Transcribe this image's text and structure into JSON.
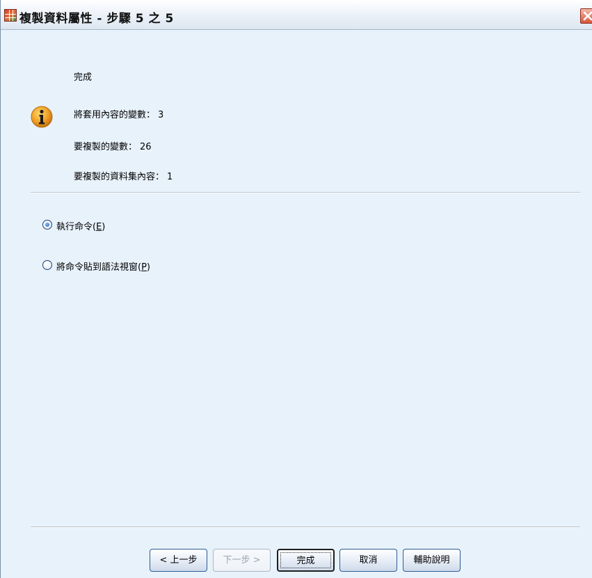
{
  "window": {
    "title": "複製資料屬性 - 步驟 5 之 5"
  },
  "content": {
    "heading": "完成",
    "stats": [
      {
        "label": "將套用內容的變數：",
        "value": "3"
      },
      {
        "label": "要複製的變數：",
        "value": "26"
      },
      {
        "label": "要複製的資料集內容：",
        "value": "1"
      }
    ]
  },
  "options": {
    "run_prefix": "執行命令(",
    "run_accel": "E",
    "run_suffix": ")",
    "paste_prefix": "將命令貼到語法視窗(",
    "paste_accel": "P",
    "paste_suffix": ")",
    "selected": "run"
  },
  "buttons": {
    "back": "< 上一步",
    "next": "下一步 >",
    "finish": "完成",
    "cancel": "取消",
    "help": "輔助說明"
  },
  "icons": {
    "app": "spss-data-grid-icon",
    "close": "close-icon",
    "info": "info-icon"
  },
  "colors": {
    "background": "#e8f2fb",
    "close_button": "#d9553a",
    "info_icon": "#f0a22a",
    "radio_selected": "#1d5fb5"
  }
}
